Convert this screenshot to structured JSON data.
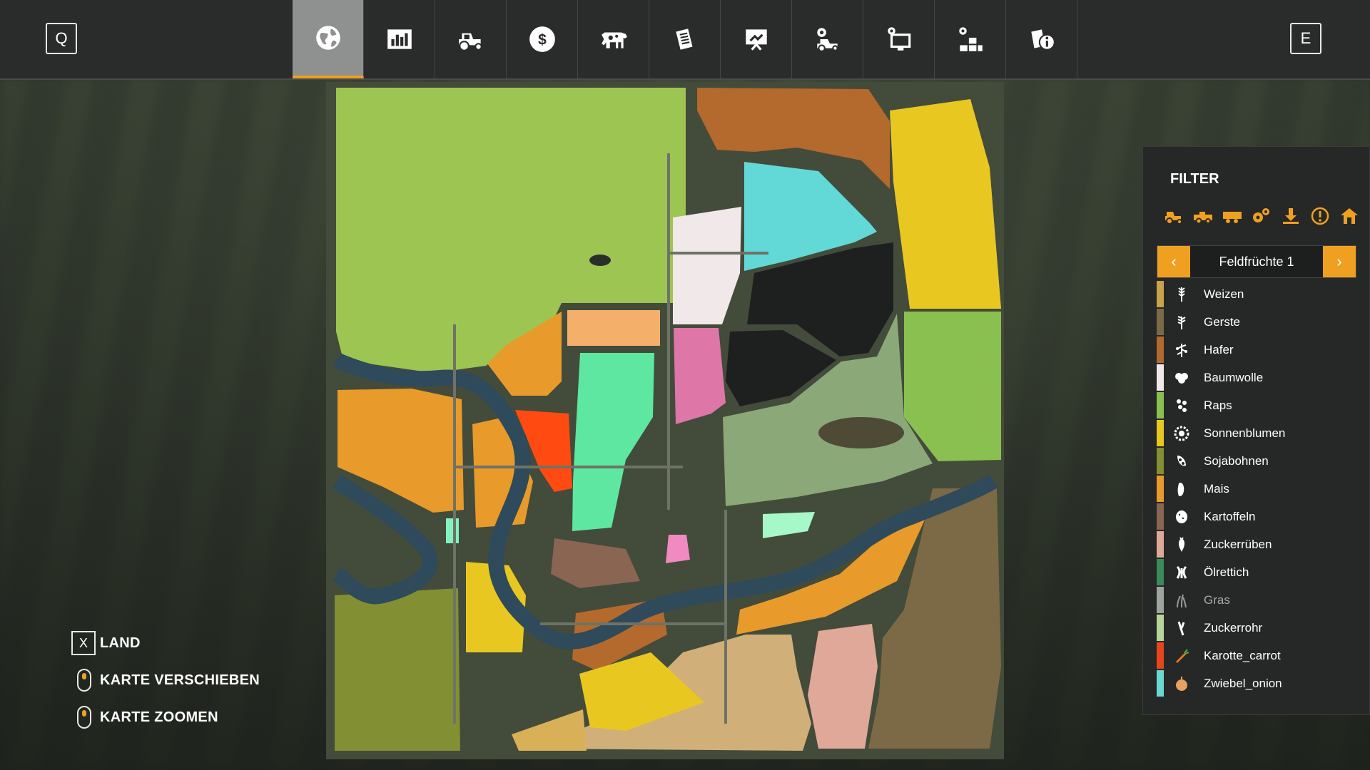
{
  "topbar": {
    "left_key": "Q",
    "right_key": "E",
    "tabs": [
      {
        "name": "map-tab",
        "icon": "globe-icon",
        "active": true
      },
      {
        "name": "statistics-tab",
        "icon": "bar-chart-icon",
        "active": false
      },
      {
        "name": "vehicles-tab",
        "icon": "tractor-icon",
        "active": false
      },
      {
        "name": "finances-tab",
        "icon": "dollar-icon",
        "active": false
      },
      {
        "name": "animals-tab",
        "icon": "cow-icon",
        "active": false
      },
      {
        "name": "contracts-tab",
        "icon": "documents-icon",
        "active": false
      },
      {
        "name": "help-tab",
        "icon": "presentation-icon",
        "active": false
      },
      {
        "name": "settings-tab",
        "icon": "tractor-gear-icon",
        "active": false
      },
      {
        "name": "display-tab",
        "icon": "monitor-gear-icon",
        "active": false
      },
      {
        "name": "production-tab",
        "icon": "pallets-gear-icon",
        "active": false
      },
      {
        "name": "info-tab",
        "icon": "info-documents-icon",
        "active": false
      }
    ]
  },
  "help": {
    "land_key": "X",
    "land_label": "LAND",
    "move_label": "KARTE VERSCHIEBEN",
    "zoom_label": "KARTE ZOOMEN"
  },
  "filter": {
    "title": "FILTER",
    "filter_icons": [
      "tractor-icon",
      "harvester-icon",
      "trailer-icon",
      "gears-icon",
      "download-icon",
      "alert-icon",
      "house-icon"
    ],
    "selector_label": "Feldfrüchte 1",
    "crops": [
      {
        "label": "Weizen",
        "color": "#c9a24a",
        "icon": "wheat-icon"
      },
      {
        "label": "Gerste",
        "color": "#7b6a45",
        "icon": "barley-icon"
      },
      {
        "label": "Hafer",
        "color": "#b26a2c",
        "icon": "oat-icon"
      },
      {
        "label": "Baumwolle",
        "color": "#f1e9e9",
        "icon": "cotton-icon"
      },
      {
        "label": "Raps",
        "color": "#8ac050",
        "icon": "canola-icon"
      },
      {
        "label": "Sonnenblumen",
        "color": "#e8c820",
        "icon": "sunflower-icon"
      },
      {
        "label": "Sojabohnen",
        "color": "#828f33",
        "icon": "soybean-icon"
      },
      {
        "label": "Mais",
        "color": "#e89a2a",
        "icon": "corn-icon"
      },
      {
        "label": "Kartoffeln",
        "color": "#8a6552",
        "icon": "potato-icon"
      },
      {
        "label": "Zuckerrüben",
        "color": "#e0a898",
        "icon": "sugarbeet-icon"
      },
      {
        "label": "Ölrettich",
        "color": "#3a8a5a",
        "icon": "oilradish-icon"
      },
      {
        "label": "Gras",
        "color": "#a0a4a0",
        "icon": "grass-icon",
        "dim": true
      },
      {
        "label": "Zuckerrohr",
        "color": "#b8d49a",
        "icon": "sugarcane-icon"
      },
      {
        "label": "Karotte_carrot",
        "color": "#e8461a",
        "icon": "carrot-icon"
      },
      {
        "label": "Zwiebel_onion",
        "color": "#6ad8d0",
        "icon": "onion-icon"
      }
    ]
  }
}
